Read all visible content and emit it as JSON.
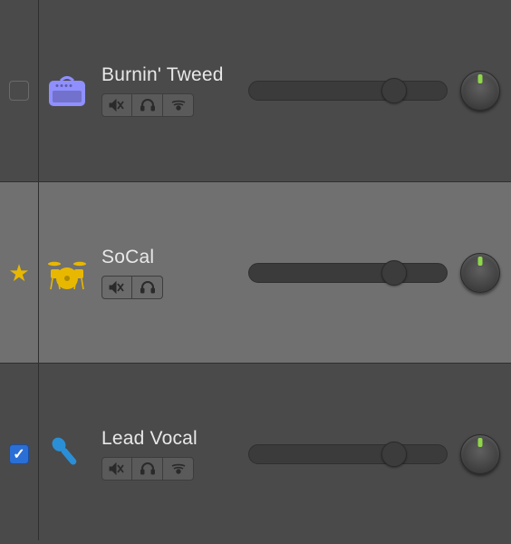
{
  "tracks": [
    {
      "name": "Burnin' Tweed",
      "icon": "amp",
      "iconColor": "#8f8fff",
      "indicator": "unchecked",
      "selected": false,
      "volume": 0.73,
      "hasWireless": true
    },
    {
      "name": "SoCal",
      "icon": "drums",
      "iconColor": "#e8b800",
      "indicator": "star",
      "selected": true,
      "volume": 0.73,
      "hasWireless": false
    },
    {
      "name": "Lead Vocal",
      "icon": "mic",
      "iconColor": "#2a8fd6",
      "indicator": "checked",
      "selected": false,
      "volume": 0.73,
      "hasWireless": true
    }
  ]
}
